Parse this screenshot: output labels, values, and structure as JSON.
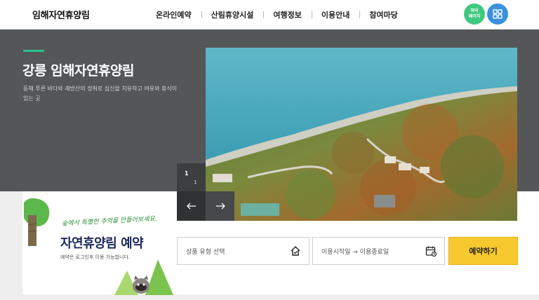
{
  "header": {
    "logo": "임해자연휴양림",
    "nav": [
      "온라인예약",
      "산림휴양시설",
      "여행정보",
      "이용안내",
      "참여마당"
    ],
    "mypage_label": "마이\n페이지",
    "menu_icon": "grid-icon"
  },
  "hero": {
    "title": "강릉 임해자연휴양림",
    "description": "동해 푸른 바다와 괘방산의 정취로 심신을 치유하고 여유와 휴식이 있는 곳",
    "image_alt": "바다와 숲이 보이는 임해자연휴양림 항공 사진"
  },
  "slider": {
    "current": "1",
    "total": "1",
    "prev_icon": "arrow-left-icon",
    "next_icon": "arrow-right-icon"
  },
  "reservation": {
    "tagline": "숲에서 특별한 추억을 만들어보세요.",
    "title": "자연휴양림 예약",
    "note": "예약은 로그인후 이용 가능합니다.",
    "product_placeholder": "상품 유형 선택",
    "date_placeholder": "이용시작일 → 이용종료일",
    "submit_label": "예약하기"
  },
  "colors": {
    "hero_bg": "#545658",
    "accent_green": "#2fbf8a",
    "mypage_green": "#3fc87f",
    "menu_blue": "#3a8fe0",
    "reserve_yellow": "#f7c92f",
    "title_navy": "#1b2a5c"
  }
}
